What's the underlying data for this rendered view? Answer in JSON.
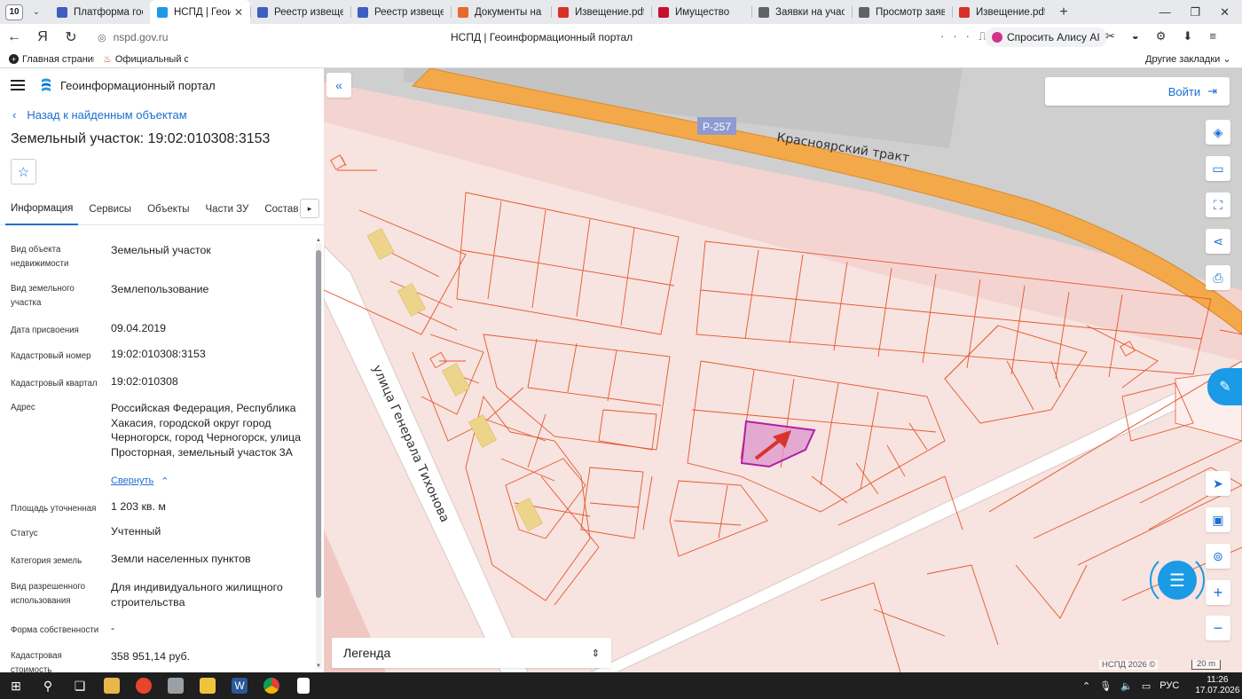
{
  "browser": {
    "tab_count": "10",
    "tabs": [
      {
        "title": "Платформа госуд",
        "icon": "eagle-icon",
        "active": false
      },
      {
        "title": "НСПД | Геоинф",
        "icon": "nspd-icon",
        "active": true
      },
      {
        "title": "Реестр извещени",
        "icon": "eagle-icon",
        "active": false
      },
      {
        "title": "Реестр извещени",
        "icon": "eagle-icon",
        "active": false
      },
      {
        "title": "Документы на ис",
        "icon": "firefox-icon",
        "active": false
      },
      {
        "title": "Извещение.pdf",
        "icon": "pdf-icon",
        "active": false
      },
      {
        "title": "Имущество",
        "icon": "rts-icon",
        "active": false
      },
      {
        "title": "Заявки на участи",
        "icon": "doc-icon",
        "active": false
      },
      {
        "title": "Просмотр заявки",
        "icon": "doc-icon",
        "active": false
      },
      {
        "title": "Извещение.pdf",
        "icon": "pdf-icon",
        "active": false
      }
    ],
    "url": "nspd.gov.ru",
    "page_title": "НСПД | Геоинформационный портал",
    "alice_label": "Спросить Алису AI",
    "bookmarks": [
      "Главная страница",
      "Официальный са"
    ],
    "other_bookmarks": "Другие закладки"
  },
  "panel": {
    "portal_title": "Геоинформационный портал",
    "back_link": "Назад к найденным объектам",
    "heading": "Земельный участок: 19:02:010308:3153",
    "tabs": [
      "Информация",
      "Сервисы",
      "Объекты",
      "Части ЗУ",
      "Состав"
    ],
    "collapse_link": "Свернуть",
    "props": [
      {
        "k": "Вид объекта недвижимости",
        "v": "Земельный участок"
      },
      {
        "k": "Вид земельного участка",
        "v": "Землепользование"
      },
      {
        "k": "Дата присвоения",
        "v": "09.04.2019"
      },
      {
        "k": "Кадастровый номер",
        "v": "19:02:010308:3153"
      },
      {
        "k": "Кадастровый квартал",
        "v": "19:02:010308"
      },
      {
        "k": "Адрес",
        "v": "Российская Федерация, Республика Хакасия, городской округ город Черногорск, город Черногорск, улица Просторная, земельный участок 3А"
      },
      {
        "k": "Площадь уточненная",
        "v": "1 203 кв. м"
      },
      {
        "k": "Статус",
        "v": "Учтенный"
      },
      {
        "k": "Категория земель",
        "v": "Земли населенных пунктов"
      },
      {
        "k": "Вид разрешенного использования",
        "v": "Для индивидуального жилищного строительства"
      },
      {
        "k": "Форма собственности",
        "v": "-"
      },
      {
        "k": "Кадастровая стоимость",
        "v": "358 951,14 руб."
      }
    ]
  },
  "map": {
    "login_label": "Войти",
    "legend_label": "Легенда",
    "road_badge": "Р-257",
    "road_name": "Красноярский тракт",
    "street_name": "улица Генерала Тихонова",
    "copyright": "НСПД 2026 ©",
    "scale": "20 m"
  },
  "taskbar": {
    "lang": "РУС",
    "time": "11:26",
    "date": "17.07.2026"
  },
  "colors": {
    "accent": "#1b6fd1",
    "parcel_line": "#e4572e",
    "selected_parcel": "#c026b8",
    "road": "#f3a94a",
    "map_bg": "#f7e3df"
  }
}
